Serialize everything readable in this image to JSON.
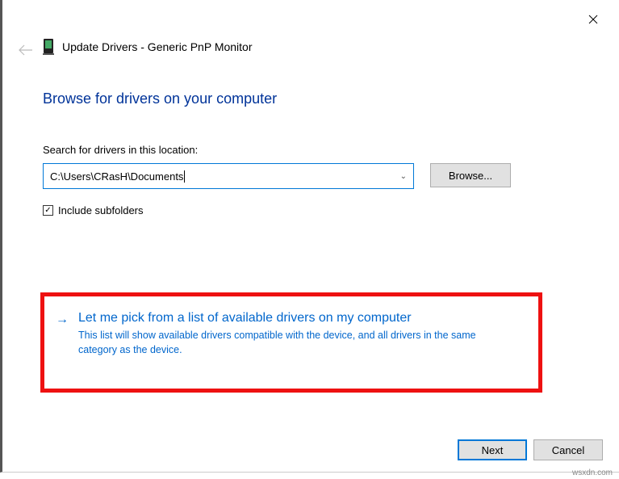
{
  "window": {
    "title": "Update Drivers - Generic PnP Monitor"
  },
  "page": {
    "heading": "Browse for drivers on your computer",
    "search_label": "Search for drivers in this location:",
    "path_value": "C:\\Users\\CRasH\\Documents",
    "browse_label": "Browse...",
    "include_subfolders_label": "Include subfolders",
    "include_subfolders_checked": true
  },
  "pick_option": {
    "title": "Let me pick from a list of available drivers on my computer",
    "description": "This list will show available drivers compatible with the device, and all drivers in the same category as the device."
  },
  "footer": {
    "next_label": "Next",
    "cancel_label": "Cancel"
  },
  "watermark": "wsxdn.com"
}
